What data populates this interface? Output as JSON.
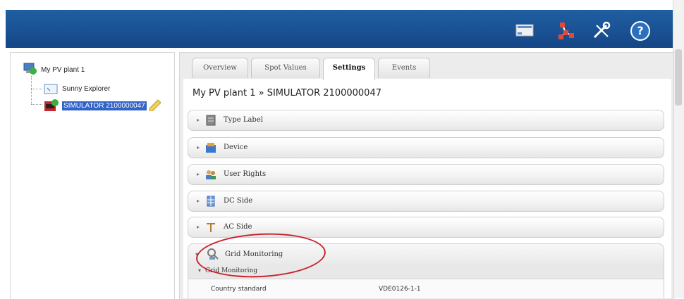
{
  "toolbar": {
    "icons": [
      "monitor-icon",
      "network-icon",
      "wrench-icon",
      "help-icon"
    ],
    "help_label": "?"
  },
  "tree": {
    "root_label": "My PV plant 1",
    "children": [
      {
        "label": "Sunny Explorer"
      },
      {
        "label": "SIMULATOR 2100000047",
        "selected": true
      }
    ]
  },
  "tabs": [
    {
      "label": "Overview"
    },
    {
      "label": "Spot Values"
    },
    {
      "label": "Settings",
      "active": true
    },
    {
      "label": "Events"
    }
  ],
  "page_title": "My PV plant 1 » SIMULATOR 2100000047",
  "sections": [
    {
      "label": "Type Label",
      "icon": "type-label-icon"
    },
    {
      "label": "Device",
      "icon": "device-icon"
    },
    {
      "label": "User Rights",
      "icon": "users-icon"
    },
    {
      "label": "DC Side",
      "icon": "dc-side-icon"
    },
    {
      "label": "AC Side",
      "icon": "ac-side-icon"
    }
  ],
  "grid_monitoring": {
    "label": "Grid Monitoring",
    "sub_label": "Grid Monitoring",
    "rows": [
      {
        "name": "Country standard",
        "value": "VDE0126-1-1"
      }
    ]
  },
  "colors": {
    "topbar": "#1a5294",
    "highlight": "#c8242b",
    "selection": "#3264c8"
  }
}
